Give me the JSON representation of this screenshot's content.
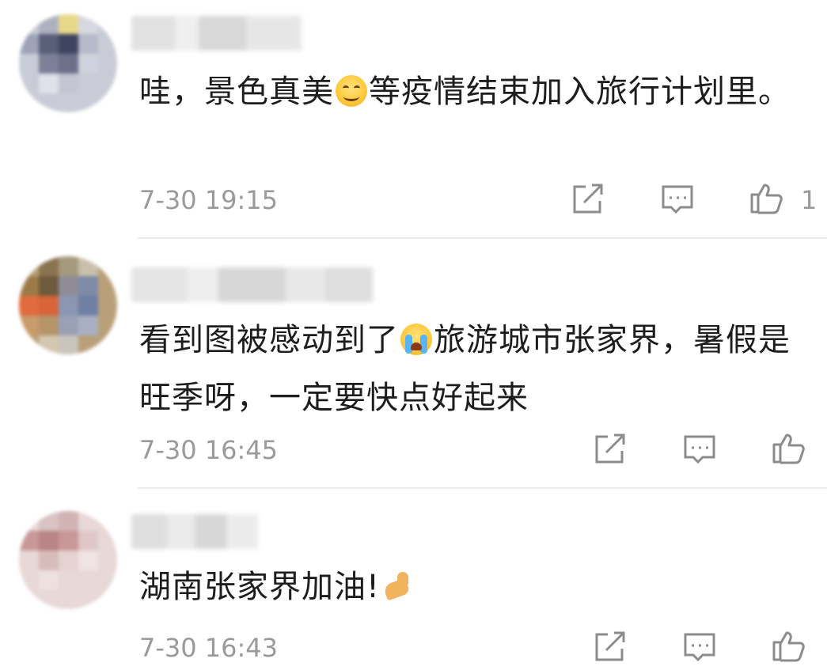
{
  "comments": [
    {
      "text_before": "哇，景色真美",
      "emoji": "smile-emoji",
      "text_after": "等疫情结束加入旅行计划里。",
      "time": "7-30 19:15",
      "like_count": "1"
    },
    {
      "text_before": "看到图被感动到了",
      "emoji": "crying-emoji",
      "text_after": "旅游城市张家界，暑假是旺季呀，一定要快点好起来",
      "time": "7-30 16:45",
      "like_count": ""
    },
    {
      "text_before": "湖南张家界加油!",
      "emoji": "flexed-biceps-emoji",
      "text_after": "",
      "time": "7-30 16:43",
      "like_count": ""
    }
  ],
  "icons": {
    "share": "share-icon",
    "reply": "comment-icon",
    "like": "thumbs-up-icon"
  },
  "colors": {
    "text": "#1d1d1d",
    "meta": "#9a9a9a",
    "divider": "#ececec"
  }
}
